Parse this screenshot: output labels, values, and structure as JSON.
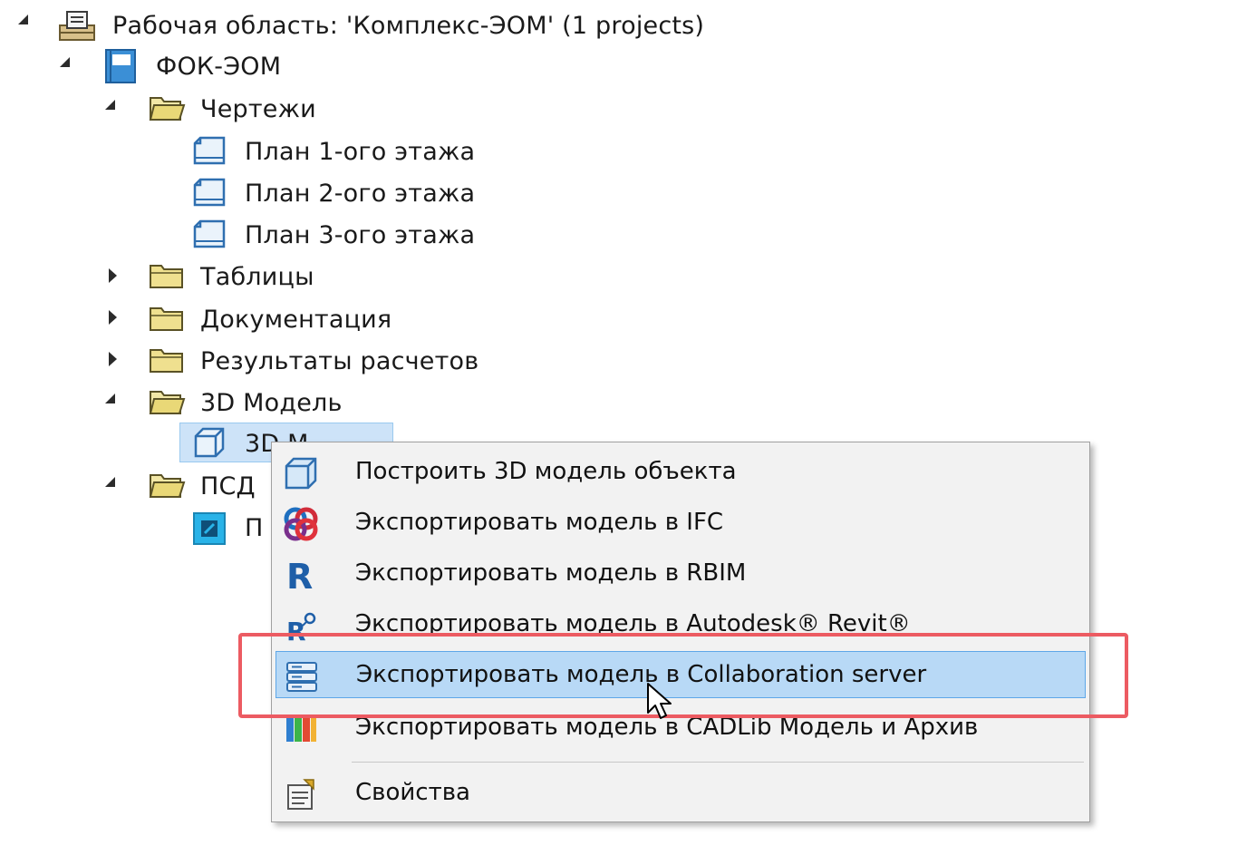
{
  "tree": {
    "workspace": {
      "label": "Рабочая область: 'Комплекс-ЭОМ' (1 projects)",
      "icon": "workspace-icon"
    },
    "project": {
      "label": "ФОК-ЭОМ",
      "icon": "project-book-icon"
    },
    "folders": [
      {
        "label": "Чертежи",
        "expanded": true,
        "icon": "open-folder-icon"
      },
      {
        "label": "Таблицы",
        "expanded": false,
        "icon": "folder-icon"
      },
      {
        "label": "Документация",
        "expanded": false,
        "icon": "folder-icon"
      },
      {
        "label": "Результаты расчетов",
        "expanded": false,
        "icon": "folder-icon"
      },
      {
        "label": "3D Модель",
        "expanded": true,
        "icon": "open-folder-icon"
      },
      {
        "label": "ПСД",
        "expanded": true,
        "icon": "open-folder-icon"
      }
    ],
    "drawings": [
      {
        "label": "План 1-ого этажа",
        "icon": "drawing-sheet-icon"
      },
      {
        "label": "План 2-ого этажа",
        "icon": "drawing-sheet-icon"
      },
      {
        "label": "План 3-ого этажа",
        "icon": "drawing-sheet-icon"
      }
    ],
    "model_item": {
      "label": "3D М",
      "icon": "cube-icon",
      "selected": true
    },
    "psd_item": {
      "label": "П",
      "icon": "psd-document-icon"
    }
  },
  "context_menu": {
    "items": [
      {
        "label": "Построить 3D модель объекта",
        "icon": "cube-icon"
      },
      {
        "label": "Экспортировать модель в IFC",
        "icon": "ifc-logo-icon"
      },
      {
        "label": "Экспортировать модель в RBIM",
        "icon": "rbim-r-icon"
      },
      {
        "label": "Экспортировать модель в Autodesk® Revit®",
        "icon": "revit-icon"
      },
      {
        "label": "Экспортировать модель в Collaboration server",
        "icon": "server-icon",
        "highlighted": true
      },
      {
        "label": "Экспортировать модель в CADLib Модель и Архив",
        "icon": "cadlib-icon"
      },
      {
        "label": "Свойства",
        "icon": "properties-icon"
      }
    ]
  },
  "colors": {
    "selection": "#cde3f8",
    "menu_highlight": "#b8d9f6",
    "annotation_box": "#ec5b62"
  }
}
